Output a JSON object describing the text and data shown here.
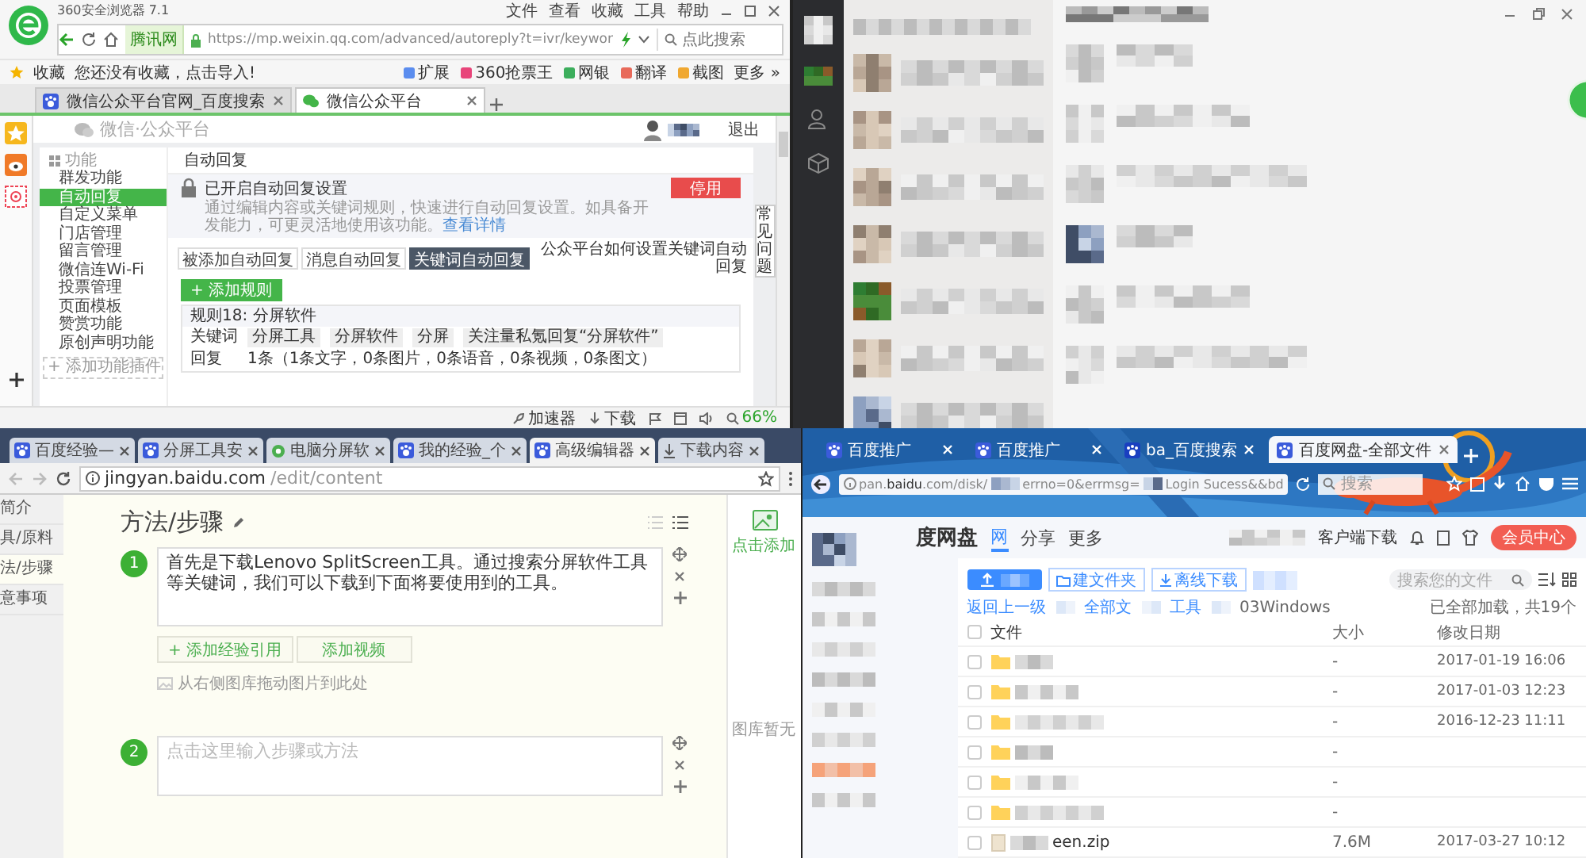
{
  "browser360": {
    "title": "360安全浏览器 7.1",
    "menu": [
      "文件",
      "查看",
      "收藏",
      "工具",
      "帮助"
    ],
    "site_label": "腾讯网",
    "url": "https://mp.weixin.qq.com/advanced/autoreply?t=ivr/keywor",
    "search_placeholder": "点此搜索",
    "bookmarks": {
      "label": "收藏",
      "hint": "您还没有收藏，点击导入!"
    },
    "tools": [
      "扩展",
      "360抢票王",
      "网银",
      "翻译",
      "截图",
      "更多 »"
    ],
    "tabs": [
      {
        "label": "微信公众平台官网_百度搜索",
        "selected": false
      },
      {
        "label": "微信公众平台",
        "selected": true
      }
    ],
    "page": {
      "logo": "微信·公众平台",
      "logout": "退出",
      "nav_header": "功能",
      "nav": [
        {
          "label": "群发功能",
          "selected": false
        },
        {
          "label": "自动回复",
          "selected": true
        },
        {
          "label": "自定义菜单",
          "selected": false
        },
        {
          "label": "门店管理",
          "selected": false
        },
        {
          "label": "留言管理",
          "selected": false
        },
        {
          "label": "微信连Wi-Fi",
          "selected": false
        },
        {
          "label": "投票管理",
          "selected": false
        },
        {
          "label": "页面模板",
          "selected": false
        },
        {
          "label": "赞赏功能",
          "selected": false
        },
        {
          "label": "原创声明功能",
          "selected": false
        }
      ],
      "add_plugin": "+ 添加功能插件",
      "section_title": "自动回复",
      "notice": {
        "title": "已开启自动回复设置",
        "text": "通过编辑内容或关键词规则，快速进行自动回复设置。如具备开发能力，可更灵活地使用该功能。",
        "link": "查看详情"
      },
      "disable_button": "停用",
      "subtabs": [
        {
          "label": "被添加自动回复",
          "selected": false
        },
        {
          "label": "消息自动回复",
          "selected": false
        },
        {
          "label": "关键词自动回复",
          "selected": true
        }
      ],
      "help_link": "公众平台如何设置关键词自动回复",
      "add_rule": "+ 添加规则",
      "rule": {
        "title": "规则18: 分屏软件",
        "keyword_label": "关键词",
        "keywords": [
          "分屏工具",
          "分屏软件",
          "分屏",
          "关注量私氪回复“分屏软件”"
        ],
        "reply_label": "回复",
        "reply": "1条（1条文字，0条图片，0条语音，0条视频，0条图文）"
      },
      "faq": "常见问题"
    },
    "status": {
      "items": [
        "加速器",
        "下载"
      ],
      "zoom": "66%"
    }
  },
  "chrome": {
    "tabs": [
      {
        "label": "百度经验—",
        "selected": false
      },
      {
        "label": "分屏工具安",
        "selected": false
      },
      {
        "label": "电脑分屏软",
        "selected": false
      },
      {
        "label": "我的经验_个",
        "selected": false
      },
      {
        "label": "高级编辑器",
        "selected": true
      },
      {
        "label": "下载内容",
        "selected": false
      }
    ],
    "url_host": "jingyan.baidu.com",
    "url_path": "/edit/content",
    "outline": [
      {
        "label": "简介",
        "selected": false
      },
      {
        "label": "具/原料",
        "selected": false
      },
      {
        "label": "法/步骤",
        "selected": true
      },
      {
        "label": "意事项",
        "selected": false
      }
    ],
    "heading": "方法/步骤",
    "steps": [
      {
        "number": "1",
        "text": "首先是下载Lenovo SplitScreen工具。通过搜索分屏软件工具等关键词，我们可以下载到下面将要使用到的工具。",
        "add_ref": "+ 添加经验引用",
        "add_video": "添加视频",
        "drop_hint": "从右侧图库拖动图片到此处"
      },
      {
        "number": "2",
        "placeholder": "点击这里输入步骤或方法"
      }
    ],
    "gallery_add": "点击添加",
    "gallery_empty": "图库暂无"
  },
  "firefox": {
    "tabs": [
      {
        "label": "百度推广",
        "selected": false
      },
      {
        "label": "百度推广",
        "selected": false
      },
      {
        "label": "ba_百度搜索",
        "selected": false
      },
      {
        "label": "百度网盘-全部文件",
        "selected": true
      }
    ],
    "url_host": "pan.baidu.com",
    "url_path": "/disk/",
    "url_mid": "errno=0&errmsg=",
    "url_tail": "Login Sucess&&bd",
    "search_placeholder": "搜索",
    "logo": "度网盘",
    "nav": [
      {
        "label": "网",
        "selected": true
      },
      {
        "label": "分享",
        "selected": false
      },
      {
        "label": "更多",
        "selected": false
      }
    ],
    "client_download": "客户端下载",
    "vip": "会员中心",
    "new_folder": "建文件夹",
    "offline": "离线下载",
    "file_search": "搜索您的文件",
    "breadcrumb": [
      "返回上一级",
      "全部文",
      "工具",
      "03Windows"
    ],
    "loaded": "已全部加载，共19个",
    "columns": [
      "文件",
      "大小",
      "修改日期"
    ],
    "select_all_checked": false,
    "rows": [
      {
        "kind": "folder",
        "checked": false,
        "size": "-",
        "date": "2017-01-19 16:06"
      },
      {
        "kind": "folder",
        "checked": false,
        "size": "-",
        "date": "2017-01-03 12:23"
      },
      {
        "kind": "folder",
        "checked": false,
        "size": "-",
        "date": "2016-12-23 11:11"
      },
      {
        "kind": "folder",
        "checked": false,
        "size": "-"
      },
      {
        "kind": "folder",
        "checked": false,
        "size": "-"
      },
      {
        "kind": "folder",
        "checked": false,
        "size": "-"
      },
      {
        "kind": "file",
        "checked": false,
        "name": "een.zip",
        "size": "7.6M",
        "date": "2017-03-27 10:12"
      }
    ]
  }
}
